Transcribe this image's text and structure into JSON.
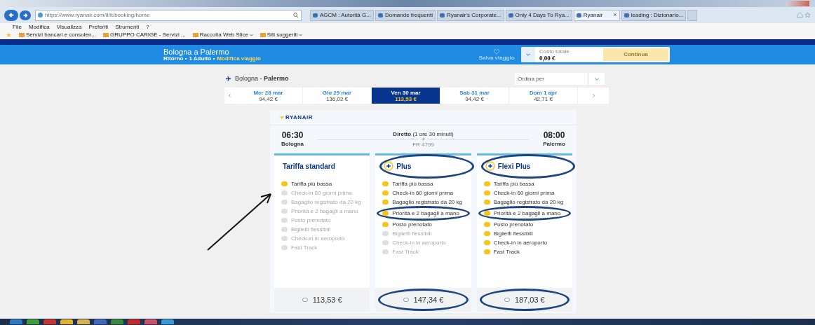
{
  "browser": {
    "address": "https://www.ryanair.com/it/it/booking/home",
    "tabs": [
      {
        "label": "AGCM : Autorità G...",
        "selected": false
      },
      {
        "label": "Domande frequenti",
        "selected": false
      },
      {
        "label": "Ryanair's Corporate...",
        "selected": false
      },
      {
        "label": "Only 4 Days To Rya...",
        "selected": false
      },
      {
        "label": "Ryanair",
        "selected": true
      },
      {
        "label": "leading : Dizionario...",
        "selected": false
      }
    ],
    "tab_close": "×",
    "menu": [
      "File",
      "Modifica",
      "Visualizza",
      "Preferiti",
      "Strumenti",
      "?"
    ],
    "favorites": [
      {
        "label": "Servizi bancari e consulen...",
        "dropdown": false
      },
      {
        "label": "GRUPPO CARIGE - Servizi ...",
        "dropdown": false
      },
      {
        "label": "Raccolta Web Slice",
        "dropdown": true
      },
      {
        "label": "Siti suggeriti",
        "dropdown": true
      }
    ]
  },
  "header": {
    "title": "Bologna a Palermo",
    "subtitle": [
      {
        "label": "Ritorno",
        "link": false
      },
      {
        "label": "1 Adulto",
        "link": false
      },
      {
        "label": "Modifica viaggio",
        "link": true
      }
    ],
    "save_trip": "Salva viaggio",
    "total_label": "Costo totale",
    "total": "0,00 €",
    "continue": "Continua"
  },
  "route": {
    "from": "Bologna",
    "separator": "-",
    "to": "Palermo",
    "sort_placeholder": "Ordina per"
  },
  "dates": [
    {
      "day": "Mer 28 mar",
      "price": "94,42 €",
      "selected": false
    },
    {
      "day": "Gio 29 mar",
      "price": "136,02 €",
      "selected": false
    },
    {
      "day": "Ven 30 mar",
      "price": "113,53 €",
      "selected": true
    },
    {
      "day": "Sab 31 mar",
      "price": "94,42 €",
      "selected": false
    },
    {
      "day": "Dom 1 apr",
      "price": "42,71 €",
      "selected": false
    }
  ],
  "flight": {
    "airline": "RYANAIR",
    "departure_time": "06:30",
    "departure_city": "Bologna",
    "type": "Diretto",
    "duration": "(1 ore 30 minuti)",
    "flight_number": "FR 4799",
    "arrival_time": "08:00",
    "arrival_city": "Palermo"
  },
  "fares": [
    {
      "kind": "standard",
      "name": "Tariffa standard",
      "price": "113,53 €",
      "selected": false,
      "features": [
        {
          "label": "Tariffa più bassa",
          "included": true
        },
        {
          "label": "Check-in 60 giorni prima",
          "included": false
        },
        {
          "label": "Bagaglio registrato da 20 kg",
          "included": false
        },
        {
          "label": "Priorità e 2 bagagli a mano",
          "included": false
        },
        {
          "label": "Posto prenotato",
          "included": false
        },
        {
          "label": "Biglietti flessibili",
          "included": false
        },
        {
          "label": "Check-in in aeroporto",
          "included": false
        },
        {
          "label": "Fast Track",
          "included": false
        }
      ]
    },
    {
      "kind": "plus",
      "name": "Plus",
      "price": "147,34 €",
      "selected": false,
      "features": [
        {
          "label": "Tariffa più bassa",
          "included": true
        },
        {
          "label": "Check-in 60 giorni prima",
          "included": true
        },
        {
          "label": "Bagaglio registrato da 20 kg",
          "included": true
        },
        {
          "label": "Priorità e 2 bagagli a mano",
          "included": true
        },
        {
          "label": "Posto prenotato",
          "included": true
        },
        {
          "label": "Biglietti flessibili",
          "included": false
        },
        {
          "label": "Check-in in aeroporto",
          "included": false
        },
        {
          "label": "Fast Track",
          "included": false
        }
      ]
    },
    {
      "kind": "plus",
      "name": "Flexi Plus",
      "price": "187,03 €",
      "selected": false,
      "features": [
        {
          "label": "Tariffa più bassa",
          "included": true
        },
        {
          "label": "Check-in 60 giorni prima",
          "included": true
        },
        {
          "label": "Bagaglio registrato da 20 kg",
          "included": true
        },
        {
          "label": "Priorità e 2 bagagli a mano",
          "included": true
        },
        {
          "label": "Posto prenotato",
          "included": true
        },
        {
          "label": "Biglietti flessibili",
          "included": true
        },
        {
          "label": "Check-in in aeroporto",
          "included": true
        },
        {
          "label": "Fast Track",
          "included": true
        }
      ]
    }
  ]
}
